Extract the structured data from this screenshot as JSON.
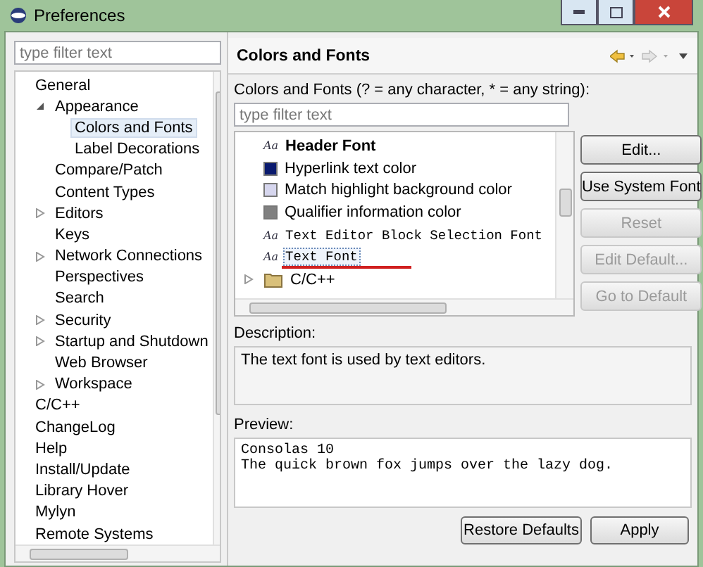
{
  "window": {
    "title": "Preferences"
  },
  "sidebar": {
    "filter": {
      "placeholder": "type filter text"
    },
    "items": [
      {
        "label": "General",
        "selected": false,
        "children": [
          {
            "label": "Appearance",
            "selected": false,
            "expanded": true,
            "children": [
              {
                "label": "Colors and Fonts",
                "selected": true
              },
              {
                "label": "Label Decorations",
                "selected": false
              }
            ]
          },
          {
            "label": "Compare/Patch",
            "selected": false
          },
          {
            "label": "Content Types",
            "selected": false
          },
          {
            "label": "Editors",
            "selected": false,
            "expanded": false
          },
          {
            "label": "Keys",
            "selected": false
          },
          {
            "label": "Network Connections",
            "selected": false,
            "expanded": false
          },
          {
            "label": "Perspectives",
            "selected": false
          },
          {
            "label": "Search",
            "selected": false
          },
          {
            "label": "Security",
            "selected": false,
            "expanded": false
          },
          {
            "label": "Startup and Shutdown",
            "selected": false,
            "expanded": false
          },
          {
            "label": "Web Browser",
            "selected": false
          },
          {
            "label": "Workspace",
            "selected": false,
            "expanded": false
          }
        ]
      },
      {
        "label": "C/C++",
        "selected": false
      },
      {
        "label": "ChangeLog",
        "selected": false
      },
      {
        "label": "Help",
        "selected": false
      },
      {
        "label": "Install/Update",
        "selected": false
      },
      {
        "label": "Library Hover",
        "selected": false
      },
      {
        "label": "Mylyn",
        "selected": false
      },
      {
        "label": "Remote Systems",
        "selected": false
      }
    ]
  },
  "page": {
    "title": "Colors and Fonts",
    "filter_label": "Colors and Fonts (? = any character, * = any string):",
    "filter": {
      "placeholder": "type filter text"
    },
    "entries": [
      {
        "kind": "font",
        "icon": "Aa",
        "label": "Header Font",
        "bold": true,
        "mono": false,
        "selected": false
      },
      {
        "kind": "color",
        "label": "Hyperlink text color",
        "color": "#0a1a6e",
        "selected": false
      },
      {
        "kind": "color",
        "label": "Match highlight background color",
        "color": "#d6d6ee",
        "selected": false
      },
      {
        "kind": "color",
        "label": "Qualifier information color",
        "color": "#808080",
        "selected": false
      },
      {
        "kind": "font",
        "icon": "Aa",
        "label": "Text Editor Block Selection Font",
        "bold": false,
        "mono": true,
        "selected": false
      },
      {
        "kind": "font",
        "icon": "Aa",
        "label": "Text Font",
        "bold": false,
        "mono": true,
        "selected": true
      },
      {
        "kind": "category",
        "label": "C/C++",
        "expanded": false,
        "selected": false
      }
    ],
    "buttons": [
      {
        "label": "Edit...",
        "disabled": false
      },
      {
        "label": "Use System Font",
        "disabled": false
      },
      {
        "label": "Reset",
        "disabled": true
      },
      {
        "label": "Edit Default...",
        "disabled": true
      },
      {
        "label": "Go to Default",
        "disabled": true
      }
    ],
    "description_label": "Description:",
    "description": "The text font is used by text editors.",
    "preview_label": "Preview:",
    "preview": [
      "Consolas 10",
      "The quick brown fox jumps over the lazy dog."
    ]
  },
  "footer_buttons": [
    "Restore Defaults",
    "Apply"
  ]
}
